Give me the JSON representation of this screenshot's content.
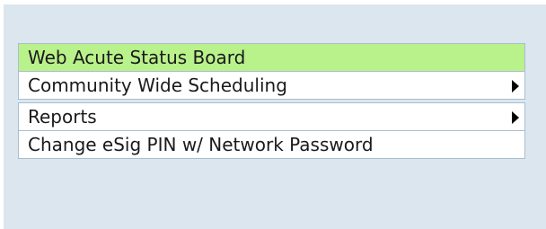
{
  "menu": {
    "items": [
      {
        "label": "Web Acute Status Board",
        "has_submenu": false,
        "icon": "",
        "highlighted": true
      },
      {
        "label": "Community Wide Scheduling",
        "has_submenu": true,
        "icon": "submenu-arrow-icon",
        "highlighted": false
      },
      {
        "label": "Reports",
        "has_submenu": true,
        "icon": "submenu-arrow-icon",
        "highlighted": false
      },
      {
        "label": "Change eSig PIN w/ Network Password",
        "has_submenu": false,
        "icon": "",
        "highlighted": false
      }
    ]
  },
  "colors": {
    "panel_background": "#dbe6ee",
    "highlight": "#b9f18a",
    "item_border": "#a8bed0"
  }
}
